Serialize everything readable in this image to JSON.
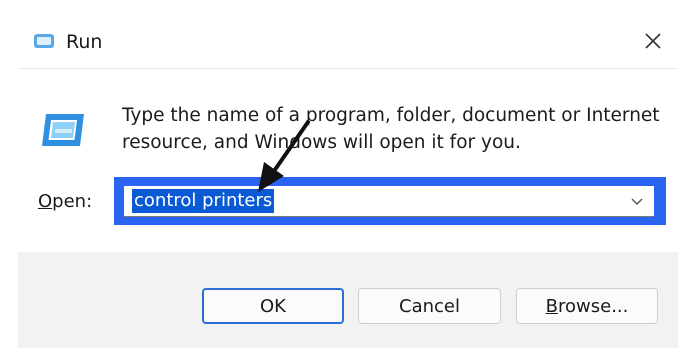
{
  "window": {
    "title": "Run",
    "icons": {
      "title_icon": "run-icon",
      "body_icon": "run-large-icon",
      "close": "close-icon",
      "dropdown": "chevron-down-icon",
      "annotation": "arrow-icon"
    }
  },
  "content": {
    "description_line1": "Type the name of a program, folder, document or Internet",
    "description_line2": "resource, and Windows will open it for you.",
    "open_label_mnemonic": "O",
    "open_label_rest": "pen:",
    "open_value": "control printers"
  },
  "buttons": {
    "ok": "OK",
    "cancel": "Cancel",
    "browse_mnemonic": "B",
    "browse_rest": "rowse..."
  },
  "colors": {
    "highlight_outline": "#2a64f0",
    "selection": "#0a5ad6",
    "default_button_border": "#2b6fd6"
  }
}
